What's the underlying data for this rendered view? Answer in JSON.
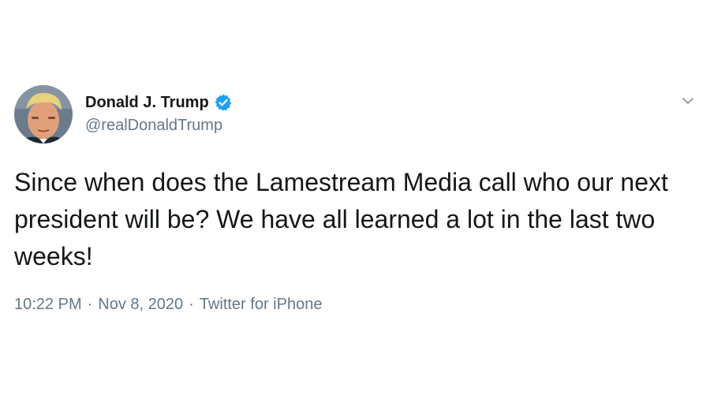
{
  "tweet": {
    "display_name": "Donald J. Trump",
    "handle": "@realDonaldTrump",
    "verified": true,
    "text": "Since when does the Lamestream Media call who our next president will be? We have all learned a lot in the last two weeks!",
    "time": "10:22 PM",
    "date": "Nov 8, 2020",
    "separator": "·",
    "source": "Twitter for iPhone"
  },
  "colors": {
    "text": "#14171a",
    "muted": "#657786",
    "verified_blue": "#1da1f2"
  },
  "icons": {
    "verified": "verified-badge-icon",
    "menu": "chevron-down-icon"
  }
}
